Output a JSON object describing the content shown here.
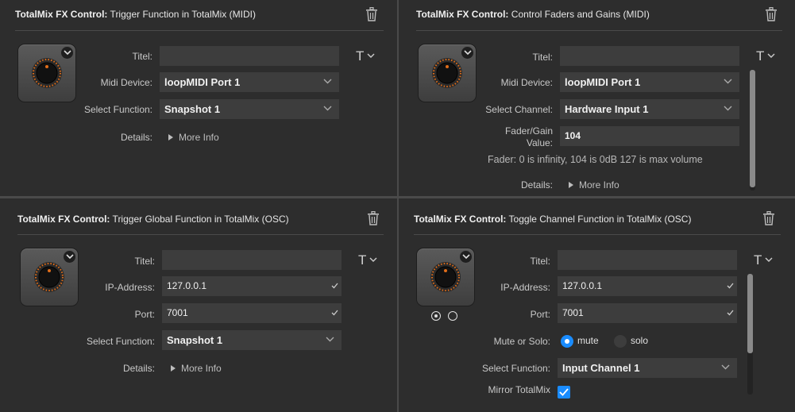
{
  "colors": {
    "background": "#2d2d2d",
    "field": "#3d3d3d",
    "accent": "#1a8cff",
    "knob_ring": "#e06d1a"
  },
  "panels": [
    {
      "title_bold": "TotalMix FX Control:",
      "title_rest": " Trigger Function in TotalMix (MIDI)",
      "rows": [
        {
          "label": "Titel:",
          "value": ""
        },
        {
          "label": "Midi Device:",
          "value": "loopMIDI Port 1"
        },
        {
          "label": "Select Function:",
          "value": "Snapshot 1"
        },
        {
          "label": "Details:",
          "value": "More Info"
        }
      ],
      "title_button": "T"
    },
    {
      "title_bold": "TotalMix FX Control:",
      "title_rest": " Control Faders and Gains (MIDI)",
      "rows": [
        {
          "label": "Titel:",
          "value": ""
        },
        {
          "label": "Midi Device:",
          "value": "loopMIDI Port 1"
        },
        {
          "label": "Select Channel:",
          "value": "Hardware Input 1"
        },
        {
          "label": "Fader/Gain",
          "label2": "Value:",
          "value": "104"
        },
        {
          "label": "Details:",
          "value": "More Info"
        }
      ],
      "note": "Fader: 0 is infinity, 104 is 0dB 127 is max volume",
      "title_button": "T"
    },
    {
      "title_bold": "TotalMix FX Control:",
      "title_rest": " Trigger Global Function in TotalMix (OSC)",
      "rows": [
        {
          "label": "Titel:",
          "value": ""
        },
        {
          "label": "IP-Address:",
          "value": "127.0.0.1"
        },
        {
          "label": "Port:",
          "value": "7001"
        },
        {
          "label": "Select Function:",
          "value": "Snapshot 1"
        },
        {
          "label": "Details:",
          "value": "More Info"
        }
      ],
      "title_button": "T"
    },
    {
      "title_bold": "TotalMix FX Control:",
      "title_rest": " Toggle Channel Function in TotalMix (OSC)",
      "rows": [
        {
          "label": "Titel:",
          "value": ""
        },
        {
          "label": "IP-Address:",
          "value": "127.0.0.1"
        },
        {
          "label": "Port:",
          "value": "7001"
        },
        {
          "label": "Mute or Solo:",
          "option_a": "mute",
          "option_b": "solo",
          "selected": "mute"
        },
        {
          "label": "Select Function:",
          "value": "Input Channel 1"
        },
        {
          "label": "Mirror TotalMix",
          "checked": true
        }
      ],
      "title_button": "T"
    }
  ]
}
